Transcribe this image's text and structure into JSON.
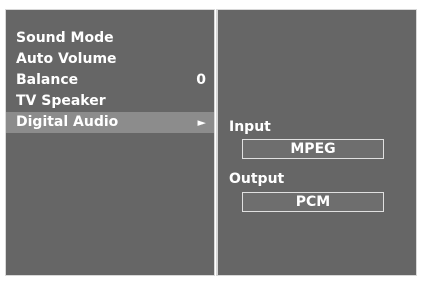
{
  "menu": {
    "items": [
      {
        "label": "Sound Mode",
        "value": ""
      },
      {
        "label": "Auto Volume",
        "value": ""
      },
      {
        "label": "Balance",
        "value": "0"
      },
      {
        "label": "TV Speaker",
        "value": ""
      },
      {
        "label": "Digital Audio",
        "value": ""
      }
    ],
    "selected_index": 4,
    "selected_arrow": "►"
  },
  "submenu": {
    "input_label": "Input",
    "input_value": "MPEG",
    "output_label": "Output",
    "output_value": "PCM"
  },
  "colors": {
    "panel_background": "#666666",
    "selected_highlight": "#8c8c8c",
    "text": "#ffffff",
    "border": "#d8d8d8"
  }
}
